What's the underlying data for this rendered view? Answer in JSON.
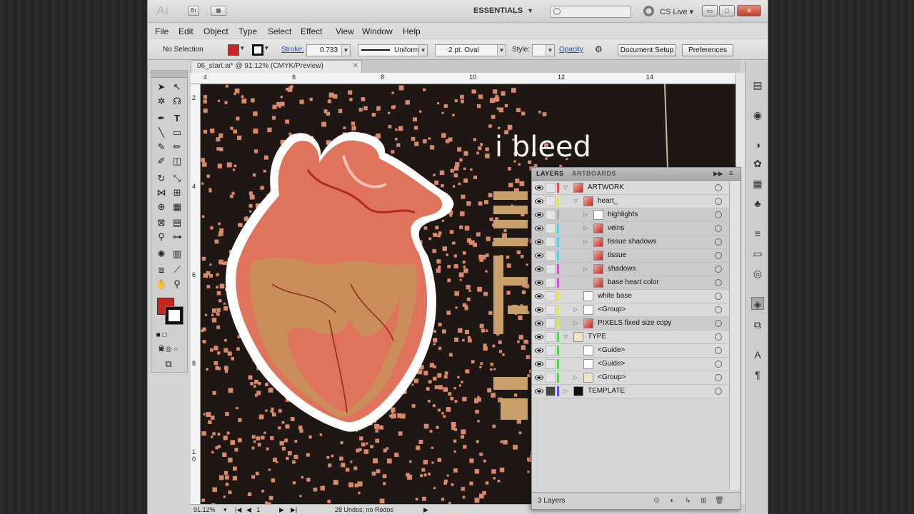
{
  "app": {
    "logo": "Ai",
    "bridge": "Br",
    "workspace": "ESSENTIALS",
    "cslive": "CS Live"
  },
  "window_controls": {
    "minimize": "▭",
    "maximize": "□",
    "close": "✕"
  },
  "menu": [
    "File",
    "Edit",
    "Object",
    "Type",
    "Select",
    "Effect",
    "View",
    "Window",
    "Help"
  ],
  "control_bar": {
    "selection": "No Selection",
    "fill_color": "#c8261e",
    "stroke_label": "Stroke:",
    "stroke_weight": "0.733",
    "stroke_profile": "Uniform",
    "brush": "2 pt. Oval",
    "style_label": "Style:",
    "opacity_label": "Opacity",
    "document_setup": "Document Setup",
    "preferences": "Preferences"
  },
  "document": {
    "tab_title": "06_start.ai* @ 91.12% (CMYK/Preview)",
    "close": "✕"
  },
  "rulers": {
    "horizontal": [
      "4",
      "6",
      "8",
      "10",
      "12",
      "14"
    ],
    "vertical": [
      "2",
      "4",
      "6",
      "8",
      "1\n0"
    ]
  },
  "artwork": {
    "headline": "i bleed",
    "background": "#1e1714"
  },
  "status": {
    "zoom": "91.12%",
    "page": "1",
    "undos": "28 Undos; no Redos"
  },
  "layers_panel": {
    "tabs": [
      "LAYERS",
      "ARTBOARDS"
    ],
    "rows": [
      {
        "name": "ARTWORK",
        "level": 0,
        "expanded": true,
        "color": "#e25555",
        "thumb": "art",
        "locked": false
      },
      {
        "name": "heart_",
        "level": 1,
        "expanded": true,
        "color": "#e4e455",
        "thumb": "art",
        "locked": false
      },
      {
        "name": "highlights",
        "level": 2,
        "expanded": false,
        "color": "#aaaaaa",
        "thumb": "blank",
        "locked": false
      },
      {
        "name": "veins",
        "level": 2,
        "expanded": false,
        "color": "#55d4e4",
        "thumb": "art",
        "locked": false
      },
      {
        "name": "tissue shadows",
        "level": 2,
        "expanded": false,
        "color": "#55d4e4",
        "thumb": "art",
        "locked": false
      },
      {
        "name": "tissue",
        "level": 2,
        "expanded": null,
        "color": "#55d4e4",
        "thumb": "art",
        "locked": false
      },
      {
        "name": "shadows",
        "level": 2,
        "expanded": false,
        "color": "#d455d4",
        "thumb": "art",
        "locked": false
      },
      {
        "name": "base heart color",
        "level": 2,
        "expanded": null,
        "color": "#d455d4",
        "thumb": "art",
        "locked": false
      },
      {
        "name": "white base",
        "level": 1,
        "expanded": null,
        "color": "#e4e455",
        "thumb": "blank",
        "locked": false
      },
      {
        "name": "<Group>",
        "level": 1,
        "expanded": false,
        "color": "#e4e455",
        "thumb": "blank",
        "locked": false
      },
      {
        "name": "PIXELS fixed size copy",
        "level": 1,
        "expanded": false,
        "color": "#e4e455",
        "thumb": "art",
        "locked": false
      },
      {
        "name": "TYPE",
        "level": 0,
        "expanded": true,
        "color": "#55d455",
        "thumb": "type",
        "locked": false
      },
      {
        "name": "<Guide>",
        "level": 1,
        "expanded": null,
        "color": "#55d455",
        "thumb": "blank",
        "locked": false
      },
      {
        "name": "<Guide>",
        "level": 1,
        "expanded": null,
        "color": "#55d455",
        "thumb": "blank",
        "locked": false
      },
      {
        "name": "<Group>",
        "level": 1,
        "expanded": false,
        "color": "#55d455",
        "thumb": "type",
        "locked": false
      },
      {
        "name": "TEMPLATE",
        "level": 0,
        "expanded": false,
        "color": "#5555e4",
        "thumb": "tmpl",
        "locked": true
      }
    ],
    "footer": "3 Layers"
  }
}
